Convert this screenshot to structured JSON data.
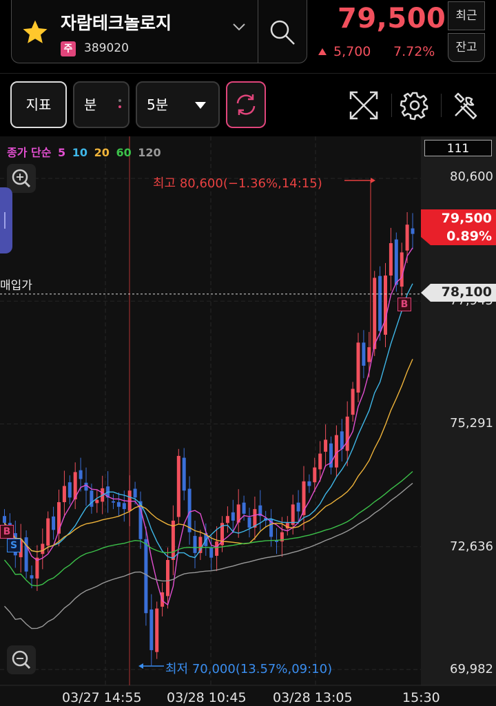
{
  "header": {
    "stock_name": "자람테크놀로지",
    "market_badge": "주",
    "stock_code": "389020",
    "price": "79,500",
    "change_value": "5,700",
    "change_pct": "7.72%",
    "recent_btn": "최근",
    "balance_btn": "잔고",
    "favorite_icon": "star-icon",
    "search_icon": "search-icon"
  },
  "toolbar": {
    "indicator_btn": "지표",
    "minute_btn": "분",
    "interval_value": "5분",
    "icons": [
      "refresh-icon",
      "fullscreen-icon",
      "gear-icon",
      "tools-icon"
    ]
  },
  "chart_labels": {
    "ma_title": "종가 단순",
    "ma_periods": [
      "5",
      "10",
      "20",
      "60",
      "120"
    ],
    "ma_colors": [
      "#e24fd0",
      "#3fb7e8",
      "#f0b43a",
      "#3cc24a",
      "#9a9a9a"
    ],
    "buy_price_label": "매입가",
    "candle_count": "111",
    "current_price": "79,500",
    "current_pct": "0.89%",
    "buy_price_value": "78,100",
    "high_annotation": "최고 80,600(−1.36%,14:15)",
    "low_annotation": "최저 70,000(13.57%,09:10)",
    "marker_buy": "B",
    "marker_sell": "S"
  },
  "colors": {
    "up": "#f2505d",
    "down": "#3a6fd8",
    "accent": "#e0457b"
  },
  "chart_data": {
    "type": "candlestick",
    "interval": "5분",
    "y_ticks": [
      "80,600",
      "77,945",
      "75,291",
      "72,636",
      "69,982"
    ],
    "y_tick_values": [
      80600,
      77945,
      75291,
      72636,
      69982
    ],
    "x_ticks": [
      "03/27 14:55",
      "03/28 10:45",
      "03/28 13:05",
      "15:30"
    ],
    "high": 80600,
    "low": 70000,
    "close": 79500,
    "buy_price": 78100,
    "closes": [
      73150,
      72850,
      72450,
      72800,
      72100,
      71950,
      72400,
      72700,
      73250,
      73000,
      73600,
      73950,
      73700,
      74250,
      74100,
      73850,
      73500,
      73650,
      73900,
      73700,
      73600,
      73500,
      73450,
      73850,
      73700,
      72800,
      71200,
      70400,
      71300,
      71650,
      72350,
      73200,
      74600,
      73850,
      72950,
      72500,
      72850,
      72650,
      72400,
      72750,
      73150,
      73300,
      73200,
      73550,
      73350,
      73050,
      73450,
      73300,
      73200,
      72850,
      72750,
      72950,
      73150,
      73550,
      73400,
      74050,
      73950,
      74350,
      74650,
      74950,
      74350,
      75050,
      74750,
      75450,
      76050,
      77050,
      76550,
      76950,
      78450,
      77300,
      78500,
      79200,
      78300,
      79000,
      79600,
      79400
    ]
  }
}
